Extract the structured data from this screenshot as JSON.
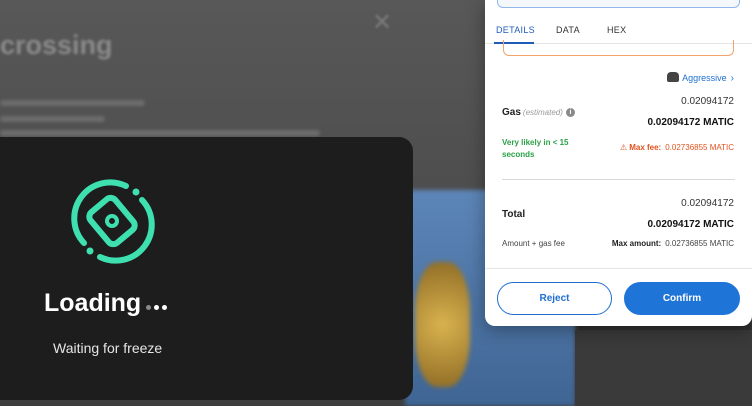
{
  "background": {
    "title": "crossing",
    "close_glyph": "✕"
  },
  "loading": {
    "title": "Loading",
    "subtitle": "Waiting for freeze",
    "logo_icon": "rotating-card-icon",
    "accent_color": "#3fe0b0"
  },
  "popup": {
    "tabs": [
      {
        "label": "DETAILS",
        "active": true
      },
      {
        "label": "DATA",
        "active": false
      },
      {
        "label": "HEX",
        "active": false
      }
    ],
    "gas_preset": {
      "label": "Aggressive",
      "icon": "gorilla-icon"
    },
    "gas": {
      "label": "Gas",
      "estimated": "(estimated)",
      "value": "0.02094172",
      "value_matic": "0.02094172 MATIC",
      "likely": "Very likely in < 15 seconds",
      "max_fee_label": "Max fee:",
      "max_fee_value": "0.02736855 MATIC"
    },
    "total": {
      "label": "Total",
      "value": "0.02094172",
      "value_matic": "0.02094172 MATIC",
      "sublabel": "Amount + gas fee",
      "max_amount_label": "Max amount:",
      "max_amount_value": "0.02736855 MATIC"
    },
    "buttons": {
      "reject": "Reject",
      "confirm": "Confirm"
    },
    "colors": {
      "primary": "#1f74d8",
      "success": "#2aa147",
      "warning": "#e0521e"
    }
  }
}
